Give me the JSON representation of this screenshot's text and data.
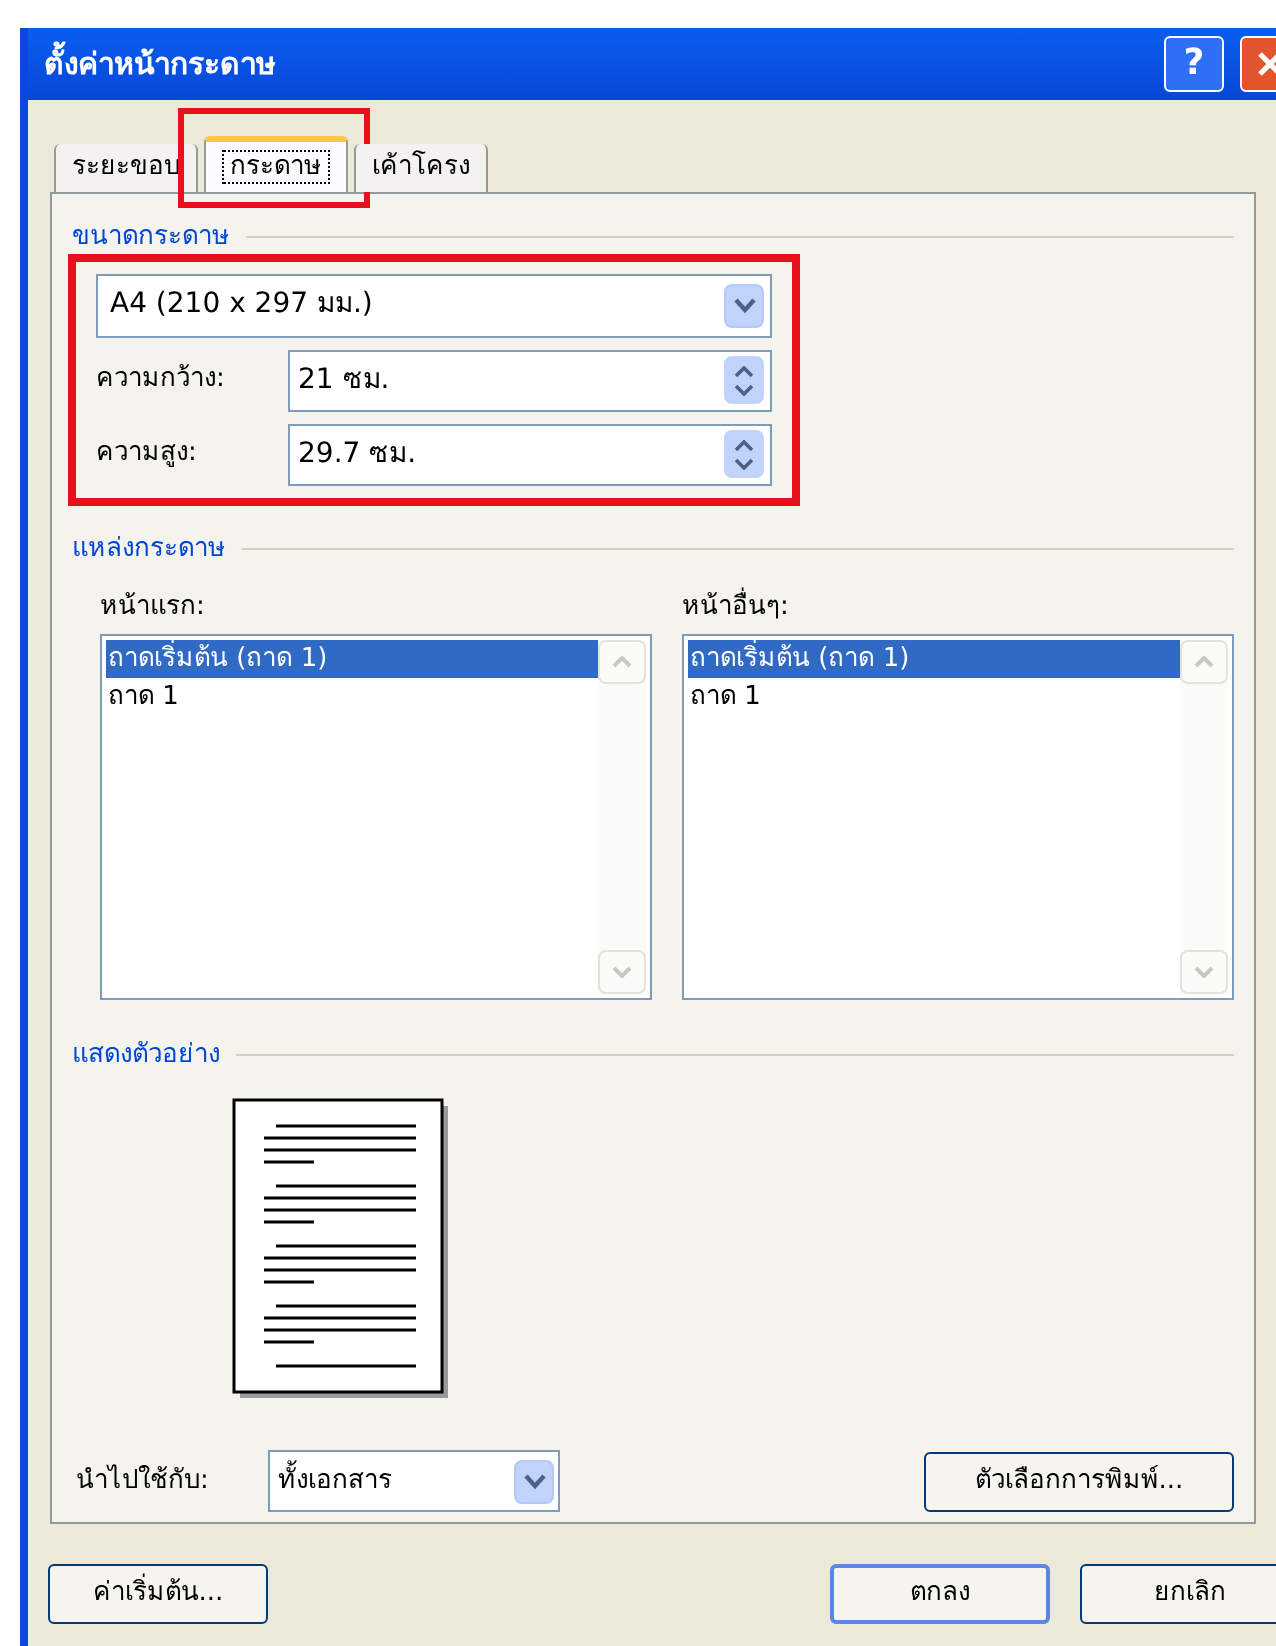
{
  "window": {
    "title": "ตั้งค่าหน้ากระดาษ",
    "help_button": "?"
  },
  "tabs": [
    {
      "label": "ระยะขอบ",
      "selected": false,
      "highlighted": false
    },
    {
      "label": "กระดาษ",
      "selected": true,
      "highlighted": true
    },
    {
      "label": "เค้าโครง",
      "selected": false,
      "highlighted": false
    }
  ],
  "paper_size": {
    "heading": "ขนาดกระดาษ",
    "highlighted": true,
    "size_select": {
      "value": "A4 (210 x 297 มม.)"
    },
    "width": {
      "label": "ความกว้าง:",
      "value": "21 ซม."
    },
    "height": {
      "label": "ความสูง:",
      "value": "29.7 ซม."
    }
  },
  "paper_source": {
    "heading": "แหล่งกระดาษ",
    "lists": [
      {
        "label": "หน้าแรก:",
        "items": [
          {
            "text": "ถาดเริ่มต้น (ถาด 1)",
            "selected": true
          },
          {
            "text": "ถาด 1",
            "selected": false
          }
        ]
      },
      {
        "label": "หน้าอื่นๆ:",
        "items": [
          {
            "text": "ถาดเริ่มต้น (ถาด 1)",
            "selected": true
          },
          {
            "text": "ถาด 1",
            "selected": false
          }
        ]
      }
    ]
  },
  "preview": {
    "heading": "แสดงตัวอย่าง"
  },
  "apply_to": {
    "label": "นำไปใช้กับ:",
    "value": "ทั้งเอกสาร"
  },
  "print_options_button": "ตัวเลือกการพิมพ์...",
  "buttons": [
    {
      "label": "ค่าเริ่มต้น...",
      "default": false
    },
    {
      "label": "ตกลง",
      "default": true
    },
    {
      "label": "ยกเลิก",
      "default": false
    }
  ]
}
